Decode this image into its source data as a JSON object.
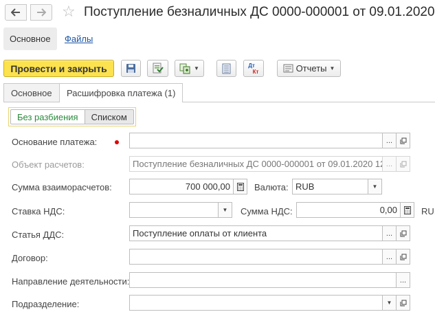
{
  "window": {
    "title": "Поступление безналичных ДС 0000-000001 от 09.01.2020"
  },
  "nav": {
    "back_icon": "arrow-left-icon",
    "forward_icon": "arrow-right-icon",
    "favorite_icon": "star-icon"
  },
  "sections": [
    {
      "label": "Основное",
      "active": true
    },
    {
      "label": "Файлы",
      "active": false
    }
  ],
  "toolbar": {
    "post_close_label": "Провести и закрыть",
    "reports_label": "Отчеты",
    "dt_kt_top": "Дт",
    "dt_kt_bottom": "Кт"
  },
  "form_tabs": [
    {
      "label": "Основное",
      "active": false
    },
    {
      "label": "Расшифровка платежа (1)",
      "active": true
    }
  ],
  "split_toggle": {
    "option1": "Без разбиения",
    "option2": "Списком"
  },
  "fields": {
    "basis_label": "Основание платежа:",
    "basis_value": "",
    "object_label": "Объект расчетов:",
    "object_value": "Поступление безналичных ДС 0000-000001 от 09.01.2020 12",
    "amount_label": "Сумма взаиморасчетов:",
    "amount_value": "700 000,00",
    "currency_label": "Валюта:",
    "currency_value": "RUB",
    "vat_rate_label": "Ставка НДС:",
    "vat_rate_value": "",
    "vat_sum_label": "Сумма НДС:",
    "vat_sum_value": "0,00",
    "vat_currency": "RUI",
    "dds_label": "Статья ДДС:",
    "dds_value": "Поступление оплаты от клиента",
    "contract_label": "Договор:",
    "contract_value": "",
    "direction_label": "Направление деятельности:",
    "direction_value": "",
    "department_label": "Подразделение:",
    "department_value": ""
  },
  "colors": {
    "primary_button": "#fbe24e",
    "link": "#1a54a6",
    "toggle_active_text": "#2a8a3c",
    "required_marker": "#e00000"
  }
}
